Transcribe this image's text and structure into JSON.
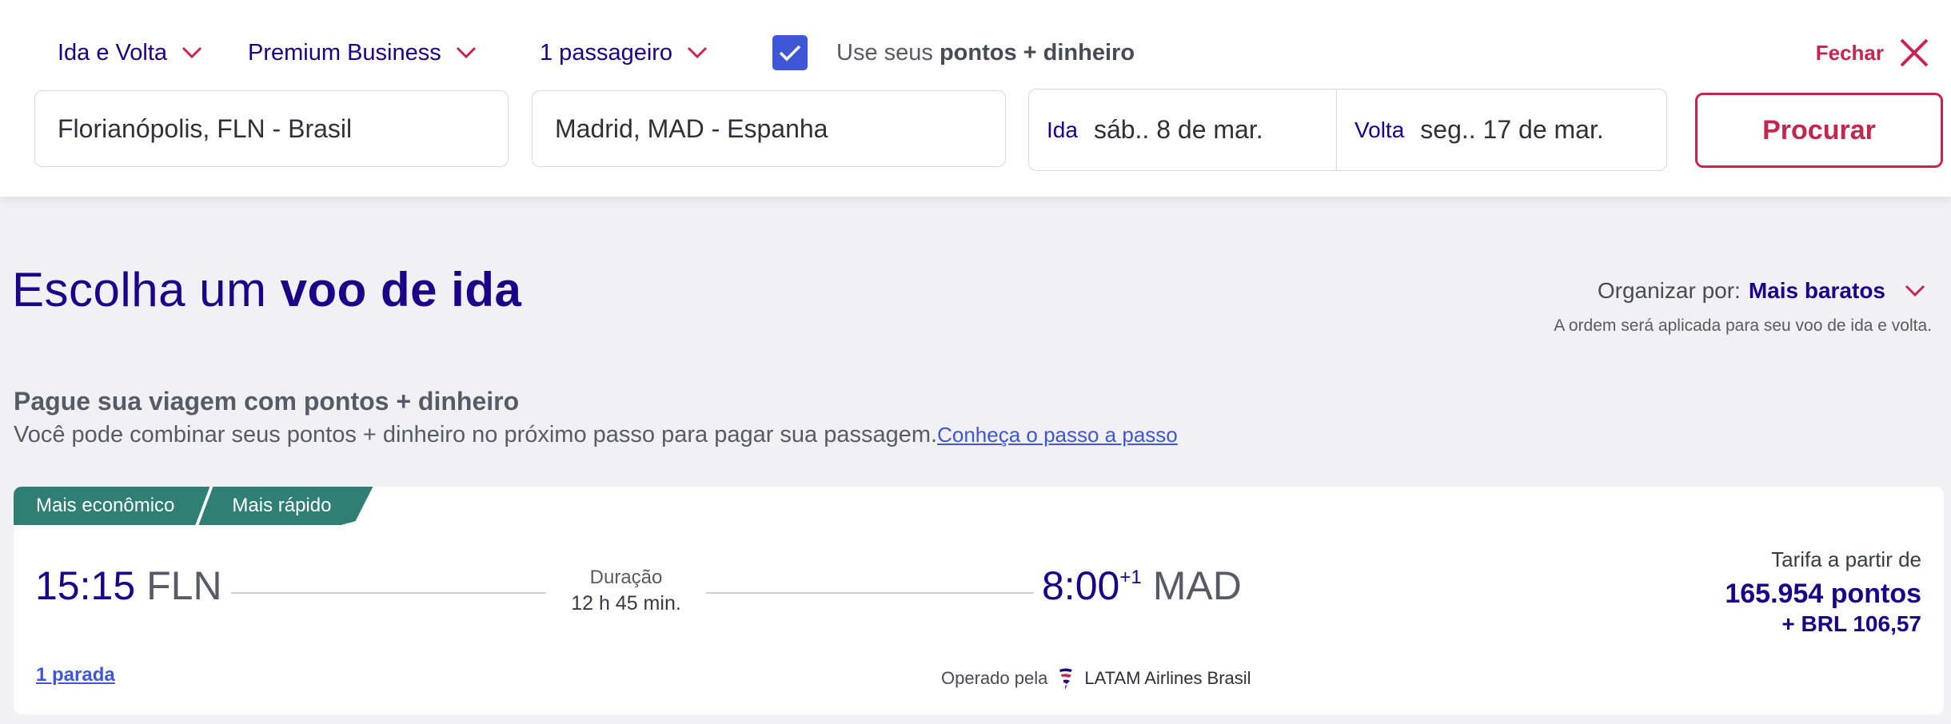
{
  "search": {
    "trip_type": "Ida e Volta",
    "cabin": "Premium Business",
    "passengers": "1 passageiro",
    "points_prefix": "Use seus",
    "points_bold": "pontos + dinheiro",
    "points_checked": true,
    "close_label": "Fechar",
    "origin": "Florianópolis, FLN - Brasil",
    "destination": "Madrid, MAD - Espanha",
    "outbound_tag": "Ida",
    "outbound_date": "sáb.. 8 de mar.",
    "return_tag": "Volta",
    "return_date": "seg.. 17 de mar.",
    "search_button": "Procurar"
  },
  "results": {
    "title_light": "Escolha um",
    "title_bold": "voo de ida",
    "sort_label": "Organizar por:",
    "sort_value": "Mais baratos",
    "sort_note": "A ordem será aplicada para seu voo de ida e volta.",
    "pay_title": "Pague sua viagem com pontos + dinheiro",
    "pay_desc": "Você pode combinar seus pontos + dinheiro no próximo passo para pagar sua passagem.",
    "pay_link": "Conheça o passo a passo"
  },
  "flights": [
    {
      "tags": [
        "Mais econômico",
        "Mais rápido"
      ],
      "dep_time": "15:15",
      "dep_code": "FLN",
      "duration_label": "Duração",
      "duration": "12 h 45 min.",
      "arr_time": "8:00",
      "arr_day_offset": "+1",
      "arr_code": "MAD",
      "fare_label": "Tarifa a partir de",
      "fare_points": "165.954 pontos",
      "fare_money": "+ BRL 106,57",
      "stops": "1 parada",
      "operated_label": "Operado pela",
      "airline": "LATAM Airlines Brasil"
    }
  ],
  "colors": {
    "brand_navy": "#1b0088",
    "brand_red": "#c7254e",
    "checkbox_blue": "#3f56d9",
    "tag_teal": "#2f7f75",
    "page_bg": "#f1f0f4"
  },
  "icons": [
    "chevron-down-icon",
    "check-icon",
    "close-icon",
    "latam-logo-icon"
  ]
}
